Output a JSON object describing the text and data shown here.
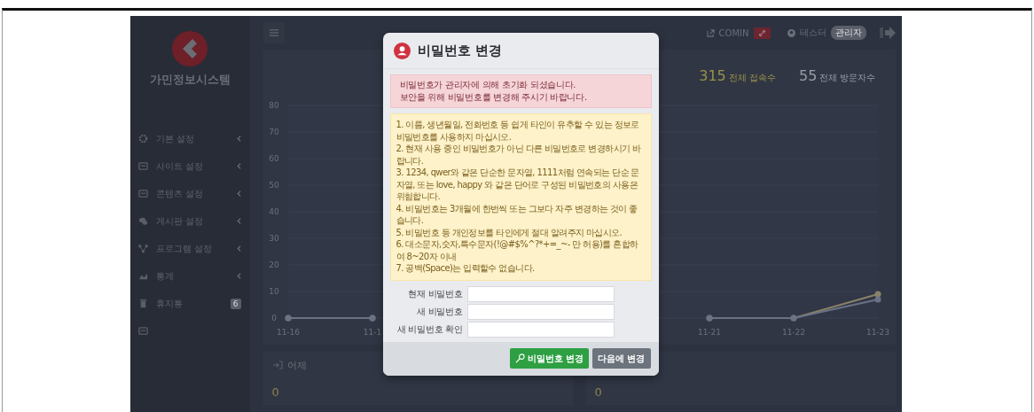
{
  "sidebar": {
    "title": "가민정보시스템",
    "items": [
      {
        "label": "기본 설정",
        "has_submenu": true
      },
      {
        "label": "사이트 설정",
        "has_submenu": true
      },
      {
        "label": "콘텐츠 설정",
        "has_submenu": true
      },
      {
        "label": "게시판 설정",
        "has_submenu": true
      },
      {
        "label": "프로그램 설정",
        "has_submenu": true
      },
      {
        "label": "통계",
        "has_submenu": true
      },
      {
        "label": "휴지통",
        "has_submenu": false,
        "badge": "6"
      },
      {
        "has_submenu": false
      }
    ]
  },
  "topbar": {
    "site_link": "COMIN",
    "user": "테스터",
    "role_badge": "관리자"
  },
  "stats": [
    {
      "value": "315",
      "label": "전체 접속수",
      "color": "#9a9348"
    },
    {
      "value": "55",
      "label": "전체 방문자수",
      "color": "#9a9ea8"
    }
  ],
  "chart_data": {
    "type": "line",
    "categories": [
      "11-16",
      "11-1",
      null,
      null,
      null,
      "11-21",
      "11-22",
      "11-23"
    ],
    "ylim": [
      0,
      80
    ],
    "yticks": [
      0,
      10,
      20,
      30,
      40,
      50,
      60,
      70,
      80
    ],
    "series": [
      {
        "color": "#8a8268",
        "marker": "circle",
        "values": [
          0,
          0,
          null,
          null,
          null,
          0,
          0,
          9
        ]
      },
      {
        "color": "#6a7286",
        "marker": "circle",
        "values": [
          0,
          0,
          null,
          null,
          null,
          0,
          0,
          7
        ]
      }
    ]
  },
  "bottom_panels": [
    {
      "title": "어제",
      "value": "0"
    },
    {
      "value": "0"
    }
  ],
  "modal": {
    "title": "비밀번호 변경",
    "alert": [
      "비밀번호가 관리자에 의해 초기화 되셨습니다.",
      "보안을 위해 비밀번호를 변경해 주시기 바랍니다."
    ],
    "rules": [
      "1. 이름, 생년월일, 전화번호 등 쉽게 타인이 유추할 수 있는 정보로 비밀번호를 사용하지 마십시오.",
      "2. 현재 사용 중인 비밀번호가 아닌 다른 비밀번호로 변경하시기 바랍니다.",
      "3. 1234, qwer와 같은 단순한 문자열, 1111처럼 연속되는 단순 문자열, 또는 love, happy 와 같은 단어로 구성된 비밀번호의 사용은 위험합니다.",
      "4. 비밀번호는 3개월에 한번씩 또는 그보다 자주 변경하는 것이 좋습니다.",
      "5. 비밀번호 등 개인정보를 타인에게 절대 알려주지 마십시오.",
      "6. 대소문자,숫자,특수문자(!@#$%^?*+=_~- 만 허용)를 혼합하여 8~20자 이내",
      "7. 공백(Space)는 입력할수 없습니다."
    ],
    "fields": [
      {
        "label": "현재 비밀번호"
      },
      {
        "label": "새 비밀번호"
      },
      {
        "label": "새 비밀번호 확인"
      }
    ],
    "buttons": [
      {
        "label": "비밀번호 변경",
        "kind": "primary"
      },
      {
        "label": "다음에 변경",
        "kind": "secondary"
      }
    ]
  }
}
